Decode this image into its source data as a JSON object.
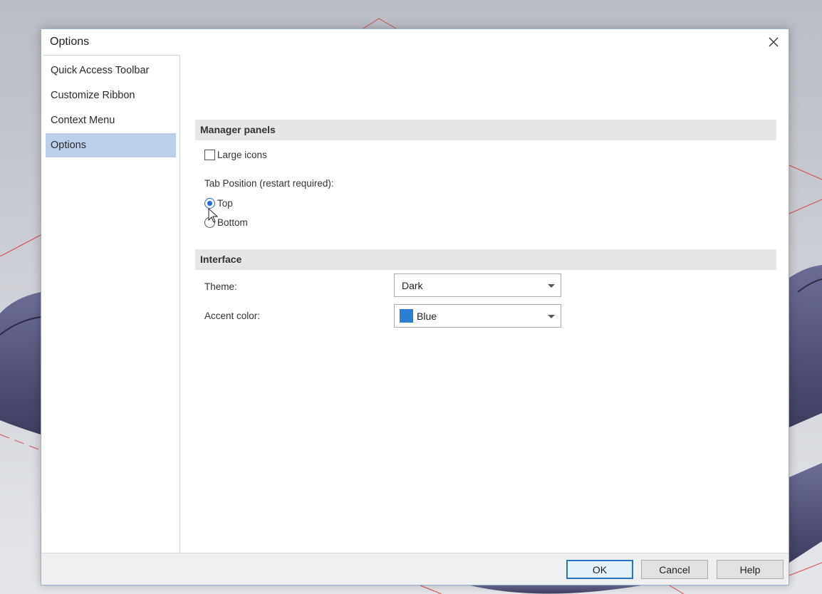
{
  "dialog": {
    "title": "Options",
    "close_icon": "close-icon"
  },
  "sidebar": {
    "items": [
      {
        "label": "Quick Access Toolbar",
        "selected": false
      },
      {
        "label": "Customize Ribbon",
        "selected": false
      },
      {
        "label": "Context Menu",
        "selected": false
      },
      {
        "label": "Options",
        "selected": true
      }
    ]
  },
  "manager_panels": {
    "header": "Manager panels",
    "large_icons_label": "Large icons",
    "large_icons_checked": false,
    "tab_position_label": "Tab Position (restart required):",
    "tab_position_options": [
      {
        "label": "Top",
        "checked": true
      },
      {
        "label": "Bottom",
        "checked": false
      }
    ]
  },
  "interface": {
    "header": "Interface",
    "theme_label": "Theme:",
    "theme_value": "Dark",
    "accent_label": "Accent color:",
    "accent_value": "Blue",
    "accent_swatch_color": "#2a7fd4"
  },
  "footer": {
    "ok_label": "OK",
    "cancel_label": "Cancel",
    "help_label": "Help"
  },
  "colors": {
    "selected_sidebar": "#bcd0ea",
    "section_header_bg": "#e6e6e6",
    "radio_accent": "#1b6dd8",
    "cad_part": "#4a4a6e"
  }
}
